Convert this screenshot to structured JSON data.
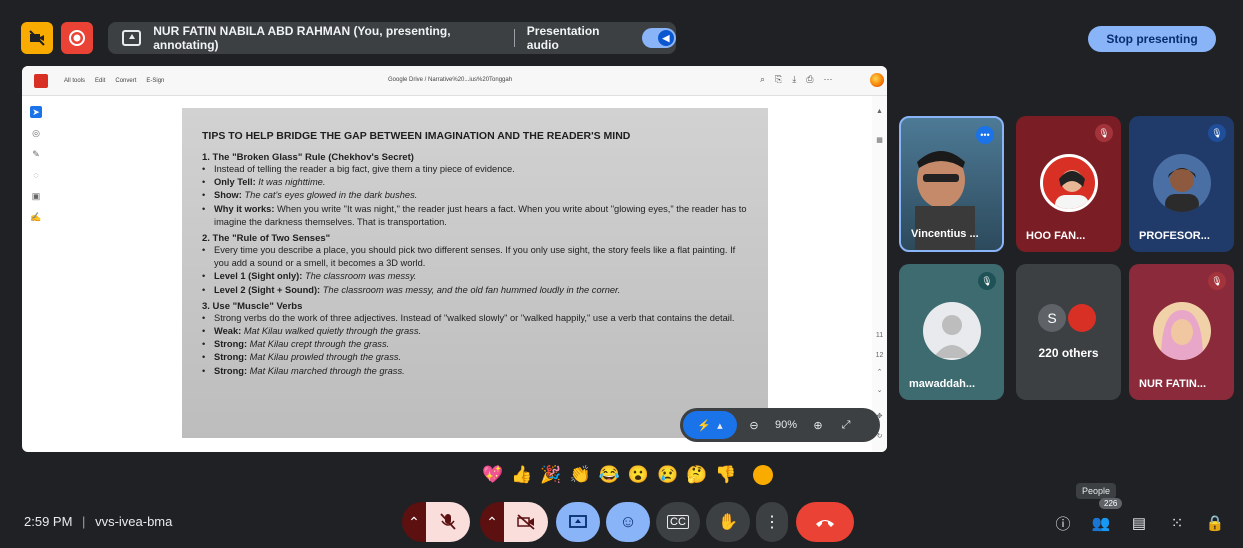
{
  "topbar": {
    "presenter_text": "NUR FATIN NABILA ABD RAHMAN (You, presenting, annotating)",
    "audio_label": "Presentation audio",
    "stop_label": "Stop presenting"
  },
  "doc_toolbar": {
    "items": [
      "All tools",
      "Edit",
      "Convert",
      "E-Sign"
    ],
    "path": "Google Drive / Narrative%20...ius%20Tonggah"
  },
  "doc": {
    "title": "TIPS TO HELP BRIDGE THE GAP BETWEEN IMAGINATION AND THE READER'S MIND",
    "s1_heading": "1. The \"Broken Glass\" Rule (Chekhov's Secret)",
    "s1_b1": "Instead of telling the reader a big fact, give them a tiny piece of evidence.",
    "s1_b2_label": "Only Tell:",
    "s1_b2_text": "It was nighttime.",
    "s1_b3_label": "Show:",
    "s1_b3_text": "The cat's eyes glowed in the dark bushes.",
    "s1_b4_label": "Why it works:",
    "s1_b4_text": "When you write \"It was night,\" the reader just hears a fact. When you write about \"glowing eyes,\" the reader has to imagine the darkness themselves. That is transportation.",
    "s2_heading": "2. The \"Rule of Two Senses\"",
    "s2_b1": "Every time you describe a place, you should pick two different senses. If you only use sight, the story feels like a flat painting. If you add a sound or a smell, it becomes a 3D world.",
    "s2_b2_label": "Level 1 (Sight only):",
    "s2_b2_text": "The classroom was messy.",
    "s2_b3_label": "Level 2 (Sight + Sound):",
    "s2_b3_text": "The classroom was messy, and the old fan hummed loudly in the corner.",
    "s3_heading": "3. Use \"Muscle\" Verbs",
    "s3_b1": "Strong verbs do the work of three adjectives. Instead of \"walked slowly\" or \"walked happily,\" use a verb that contains the detail.",
    "s3_b2_label": "Weak:",
    "s3_b2_text": "Mat Kilau walked quietly through the grass.",
    "s3_b3_label": "Strong:",
    "s3_b3_text": "Mat Kilau crept through the grass.",
    "s3_b4_label": "Strong:",
    "s3_b4_text": "Mat Kilau prowled through the grass.",
    "s3_b5_label": "Strong:",
    "s3_b5_text": "Mat Kilau marched through the grass."
  },
  "page_numbers": [
    "11",
    "12"
  ],
  "zoom": {
    "level": "90%"
  },
  "participants": [
    {
      "name": "Vincentius ...",
      "bg": "#3c6e8f"
    },
    {
      "name": "HOO FAN...",
      "bg": "#7a1d24"
    },
    {
      "name": "PROFESOR...",
      "bg": "#203a6a"
    },
    {
      "name": "mawaddah...",
      "bg": "#3d6b70"
    },
    {
      "name": "220 others",
      "bg": "#3c4043",
      "initial": "S"
    },
    {
      "name": "NUR FATIN...",
      "bg": "#8a2a3a"
    }
  ],
  "reactions": [
    "💖",
    "👍",
    "🎉",
    "👏",
    "😂",
    "😮",
    "😢",
    "🤔",
    "👎"
  ],
  "bottom": {
    "time": "2:59 PM",
    "meeting_code": "vvs-ivea-bma",
    "people_tooltip": "People",
    "people_count": "226"
  },
  "colors": {
    "background": "#202124",
    "accent_blue": "#8ab4f8",
    "end_call": "#ea4335",
    "muted_red": "#f28b82"
  }
}
